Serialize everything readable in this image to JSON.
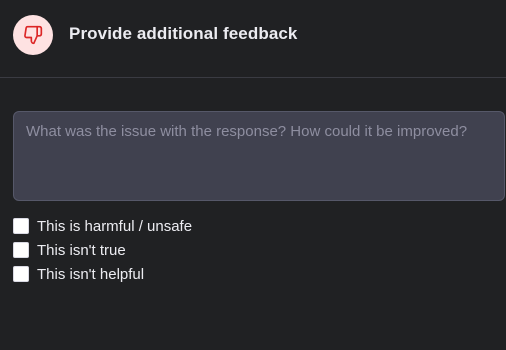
{
  "header": {
    "icon": "thumbs-down-icon",
    "icon_color": "#dc2626",
    "icon_bg": "#fee2e2",
    "title": "Provide additional feedback"
  },
  "feedback": {
    "placeholder": "What was the issue with the response? How could it be improved?",
    "value": ""
  },
  "options": [
    {
      "label": "This is harmful / unsafe",
      "checked": false
    },
    {
      "label": "This isn't true",
      "checked": false
    },
    {
      "label": "This isn't helpful",
      "checked": false
    }
  ],
  "colors": {
    "background": "#202123",
    "input_bg": "#40414f",
    "text": "#ececf1",
    "placeholder": "#8e8ea0"
  }
}
